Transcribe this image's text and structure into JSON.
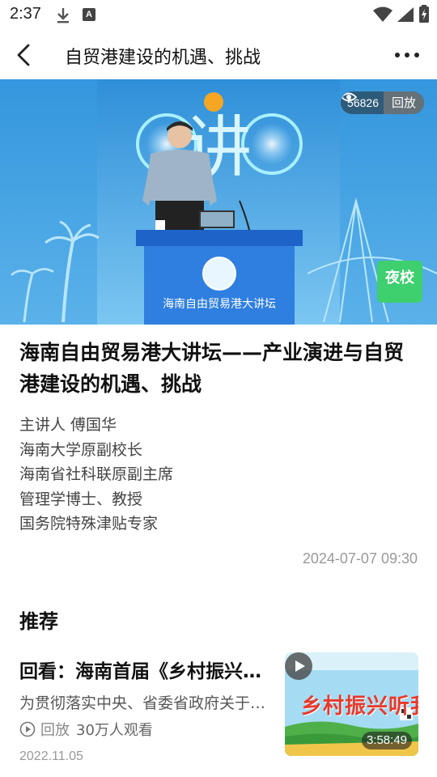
{
  "status_bar": {
    "time": "2:37",
    "icons": [
      "download-icon",
      "a-icon",
      "wifi-icon",
      "signal-icon",
      "battery-charging-icon"
    ]
  },
  "nav": {
    "title": "自贸港建设的机遇、挑战",
    "back_icon": "back-arrow-icon",
    "more_icon": "more-dots-icon"
  },
  "video": {
    "view_count": "56826",
    "replay_label": "回放",
    "logo_text": "夜校",
    "backdrop_text": "讲",
    "podium_text": "海南自由贸易港大讲坛"
  },
  "article": {
    "title": "海南自由贸易港大讲坛——产业演进与自贸港建设的机遇、挑战",
    "speaker_lines": [
      "主讲人 傅国华",
      "海南大学原副校长",
      "海南省社科联原副主席",
      "管理学博士、教授",
      "国务院特殊津贴专家"
    ],
    "publish_time": "2024-07-07 09:30"
  },
  "recommend": {
    "heading": "推荐",
    "items": [
      {
        "title": "回看：海南首届《乡村振兴听我讲》",
        "description": "为贯彻落实中央、省委省政府关于乡村振兴的决策部署",
        "replay_label": "回放",
        "viewers": "30万人观看",
        "date": "2022.11.05",
        "duration": "3:58:49",
        "thumb_title": "乡村振兴听我讲"
      }
    ]
  },
  "colors": {
    "accent_green": "#3ecf6e",
    "thumb_red": "#e8392b",
    "meta_gray": "#999999"
  }
}
